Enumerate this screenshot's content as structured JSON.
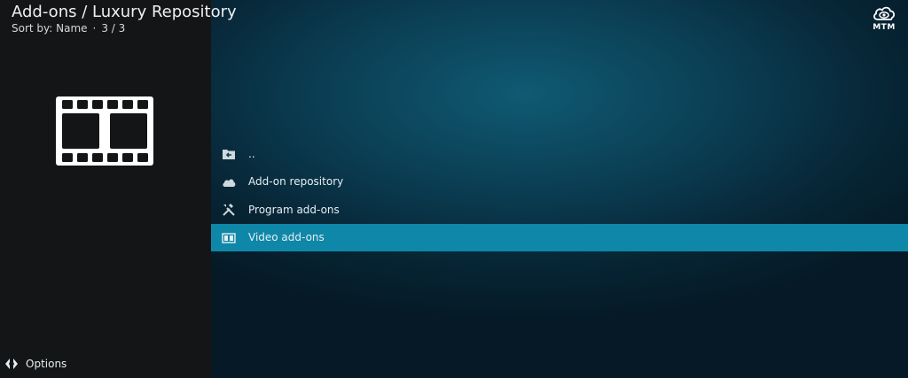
{
  "header": {
    "title": "Add-ons / Luxury Repository",
    "sort_label": "Sort by: Name",
    "separator": "·",
    "count": "3 / 3"
  },
  "brand": {
    "logo_text": "MTM"
  },
  "list": {
    "items": [
      {
        "label": "..",
        "icon": "parent-folder-icon",
        "focused": false
      },
      {
        "label": "Add-on repository",
        "icon": "cloud-icon",
        "focused": false
      },
      {
        "label": "Program add-ons",
        "icon": "tools-icon",
        "focused": false
      },
      {
        "label": "Video add-ons",
        "icon": "film-icon",
        "focused": true
      }
    ]
  },
  "footer": {
    "options_label": "Options"
  },
  "colors": {
    "highlight": "#0f87a8",
    "panel": "#141516",
    "background": "#0b3f55",
    "text": "#e6eef2"
  }
}
